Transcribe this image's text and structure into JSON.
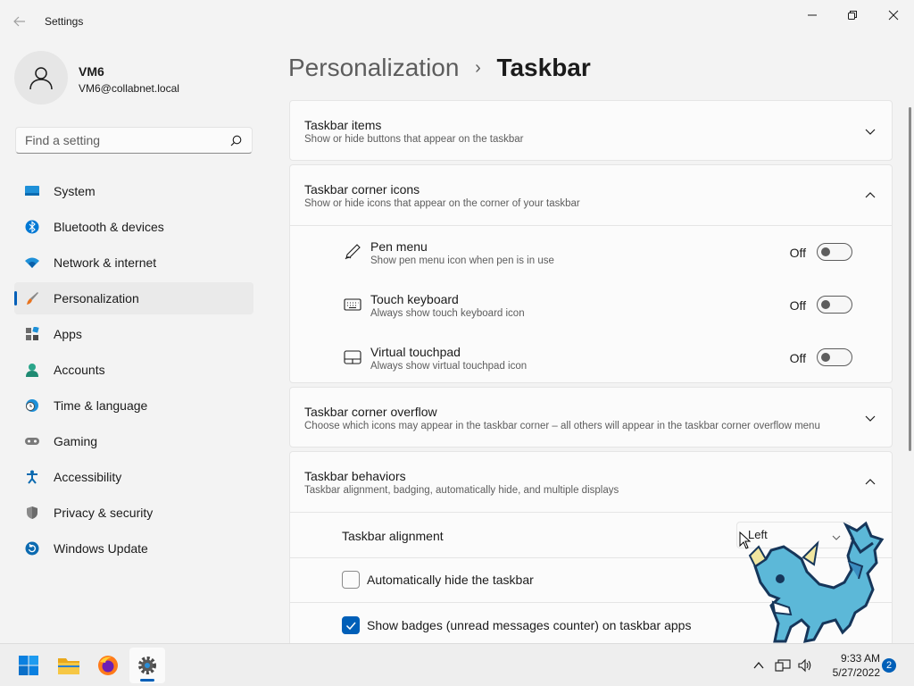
{
  "window": {
    "title": "Settings",
    "controls": {
      "minimize": "minimize",
      "maximize": "restore",
      "close": "close"
    }
  },
  "profile": {
    "name": "VM6",
    "email": "VM6@collabnet.local"
  },
  "search": {
    "placeholder": "Find a setting"
  },
  "sidebar": {
    "items": [
      {
        "label": "System",
        "icon": "system-icon",
        "active": false
      },
      {
        "label": "Bluetooth & devices",
        "icon": "bluetooth-icon",
        "active": false
      },
      {
        "label": "Network & internet",
        "icon": "wifi-icon",
        "active": false
      },
      {
        "label": "Personalization",
        "icon": "brush-icon",
        "active": true
      },
      {
        "label": "Apps",
        "icon": "apps-icon",
        "active": false
      },
      {
        "label": "Accounts",
        "icon": "person-icon",
        "active": false
      },
      {
        "label": "Time & language",
        "icon": "clock-globe-icon",
        "active": false
      },
      {
        "label": "Gaming",
        "icon": "gamepad-icon",
        "active": false
      },
      {
        "label": "Accessibility",
        "icon": "accessibility-icon",
        "active": false
      },
      {
        "label": "Privacy & security",
        "icon": "shield-icon",
        "active": false
      },
      {
        "label": "Windows Update",
        "icon": "update-icon",
        "active": false
      }
    ]
  },
  "breadcrumb": {
    "parent": "Personalization",
    "separator": "›",
    "current": "Taskbar"
  },
  "sections": {
    "items": {
      "title": "Taskbar items",
      "subtitle": "Show or hide buttons that appear on the taskbar",
      "expanded": false
    },
    "corner_icons": {
      "title": "Taskbar corner icons",
      "subtitle": "Show or hide icons that appear on the corner of your taskbar",
      "expanded": true,
      "rows": [
        {
          "title": "Pen menu",
          "subtitle": "Show pen menu icon when pen is in use",
          "state": "Off",
          "icon": "pen-icon"
        },
        {
          "title": "Touch keyboard",
          "subtitle": "Always show touch keyboard icon",
          "state": "Off",
          "icon": "keyboard-icon"
        },
        {
          "title": "Virtual touchpad",
          "subtitle": "Always show virtual touchpad icon",
          "state": "Off",
          "icon": "touchpad-icon"
        }
      ]
    },
    "overflow": {
      "title": "Taskbar corner overflow",
      "subtitle": "Choose which icons may appear in the taskbar corner – all others will appear in the taskbar corner overflow menu",
      "expanded": false
    },
    "behaviors": {
      "title": "Taskbar behaviors",
      "subtitle": "Taskbar alignment, badging, automatically hide, and multiple displays",
      "expanded": true,
      "alignment_label": "Taskbar alignment",
      "alignment_value": "Left",
      "autohide_label": "Automatically hide the taskbar",
      "autohide_checked": false,
      "badges_label": "Show badges (unread messages counter) on taskbar apps",
      "badges_checked": true
    }
  },
  "taskbar": {
    "apps": [
      "start-icon",
      "file-explorer-icon",
      "firefox-icon",
      "settings-gear-icon"
    ],
    "time": "9:33 AM",
    "date": "5/27/2022",
    "notification_count": "2"
  },
  "colors": {
    "accent": "#005fb8",
    "background": "#f3f3f3",
    "card": "#fbfbfb"
  }
}
